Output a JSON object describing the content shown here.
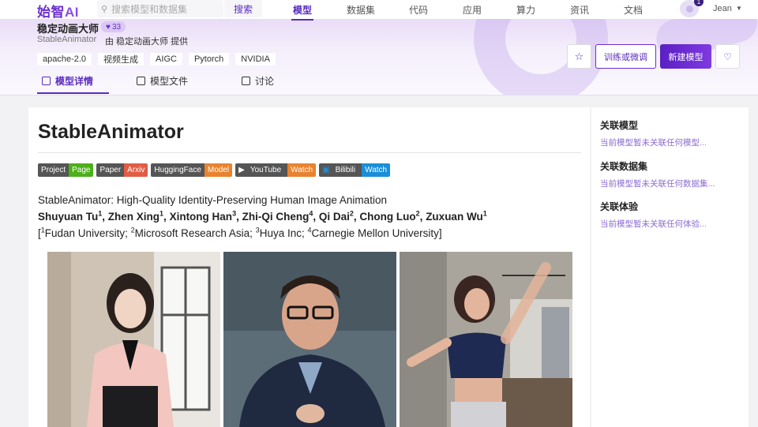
{
  "topnav": {
    "logo_main": "始智",
    "logo_ai": "AI",
    "search_placeholder": "搜索模型和数据集",
    "search_button": "搜索",
    "items": [
      "模型",
      "数据集",
      "代码",
      "应用",
      "算力",
      "资讯",
      "文档"
    ],
    "active": "模型",
    "notification_count": "1",
    "username": "Jean"
  },
  "header": {
    "title": "稳定动画大师",
    "likes": "33",
    "model_id": "StableAnimator",
    "provider": "由 稳定动画大师 提供",
    "tags": [
      "apache-2.0",
      "视频生成",
      "AIGC",
      "Pytorch",
      "NVIDIA"
    ],
    "train_button": "训练或微调",
    "new_model_button": "新建模型",
    "tabs": [
      "模型详情",
      "模型文件",
      "讨论"
    ]
  },
  "readme": {
    "heading": "StableAnimator",
    "badges": [
      {
        "left": "Project",
        "right": "Page",
        "color": "#4caf1c"
      },
      {
        "left": "Paper",
        "right": "Arxiv",
        "color": "#e05d44"
      },
      {
        "left": "HuggingFace",
        "right": "Model",
        "color": "#e8832f"
      },
      {
        "left": "YouTube",
        "right": "Watch",
        "color": "#e8832f"
      },
      {
        "left": "Bilibili",
        "right": "Watch",
        "color": "#1a8fd8"
      }
    ],
    "description": "StableAnimator: High-Quality Identity-Preserving Human Image Animation",
    "authors": [
      {
        "name": "Shuyuan Tu",
        "aff": "1"
      },
      {
        "name": "Zhen Xing",
        "aff": "1"
      },
      {
        "name": "Xintong Han",
        "aff": "3"
      },
      {
        "name": "Zhi-Qi Cheng",
        "aff": "4"
      },
      {
        "name": "Qi Dai",
        "aff": "2"
      },
      {
        "name": "Chong Luo",
        "aff": "2"
      },
      {
        "name": "Zuxuan Wu",
        "aff": "1"
      }
    ],
    "affiliations": [
      {
        "num": "1",
        "name": "Fudan University"
      },
      {
        "num": "2",
        "name": "Microsoft Research Asia"
      },
      {
        "num": "3",
        "name": "Huya Inc"
      },
      {
        "num": "4",
        "name": "Carnegie Mellon University"
      }
    ]
  },
  "sidebar": {
    "sections": [
      {
        "title": "关联模型",
        "empty": "当前模型暂未关联任何模型..."
      },
      {
        "title": "关联数据集",
        "empty": "当前模型暂未关联任何数据集..."
      },
      {
        "title": "关联体验",
        "empty": "当前模型暂未关联任何体验..."
      }
    ]
  },
  "colors": {
    "accent": "#5a2cc0",
    "button": "#6b2fd1"
  }
}
